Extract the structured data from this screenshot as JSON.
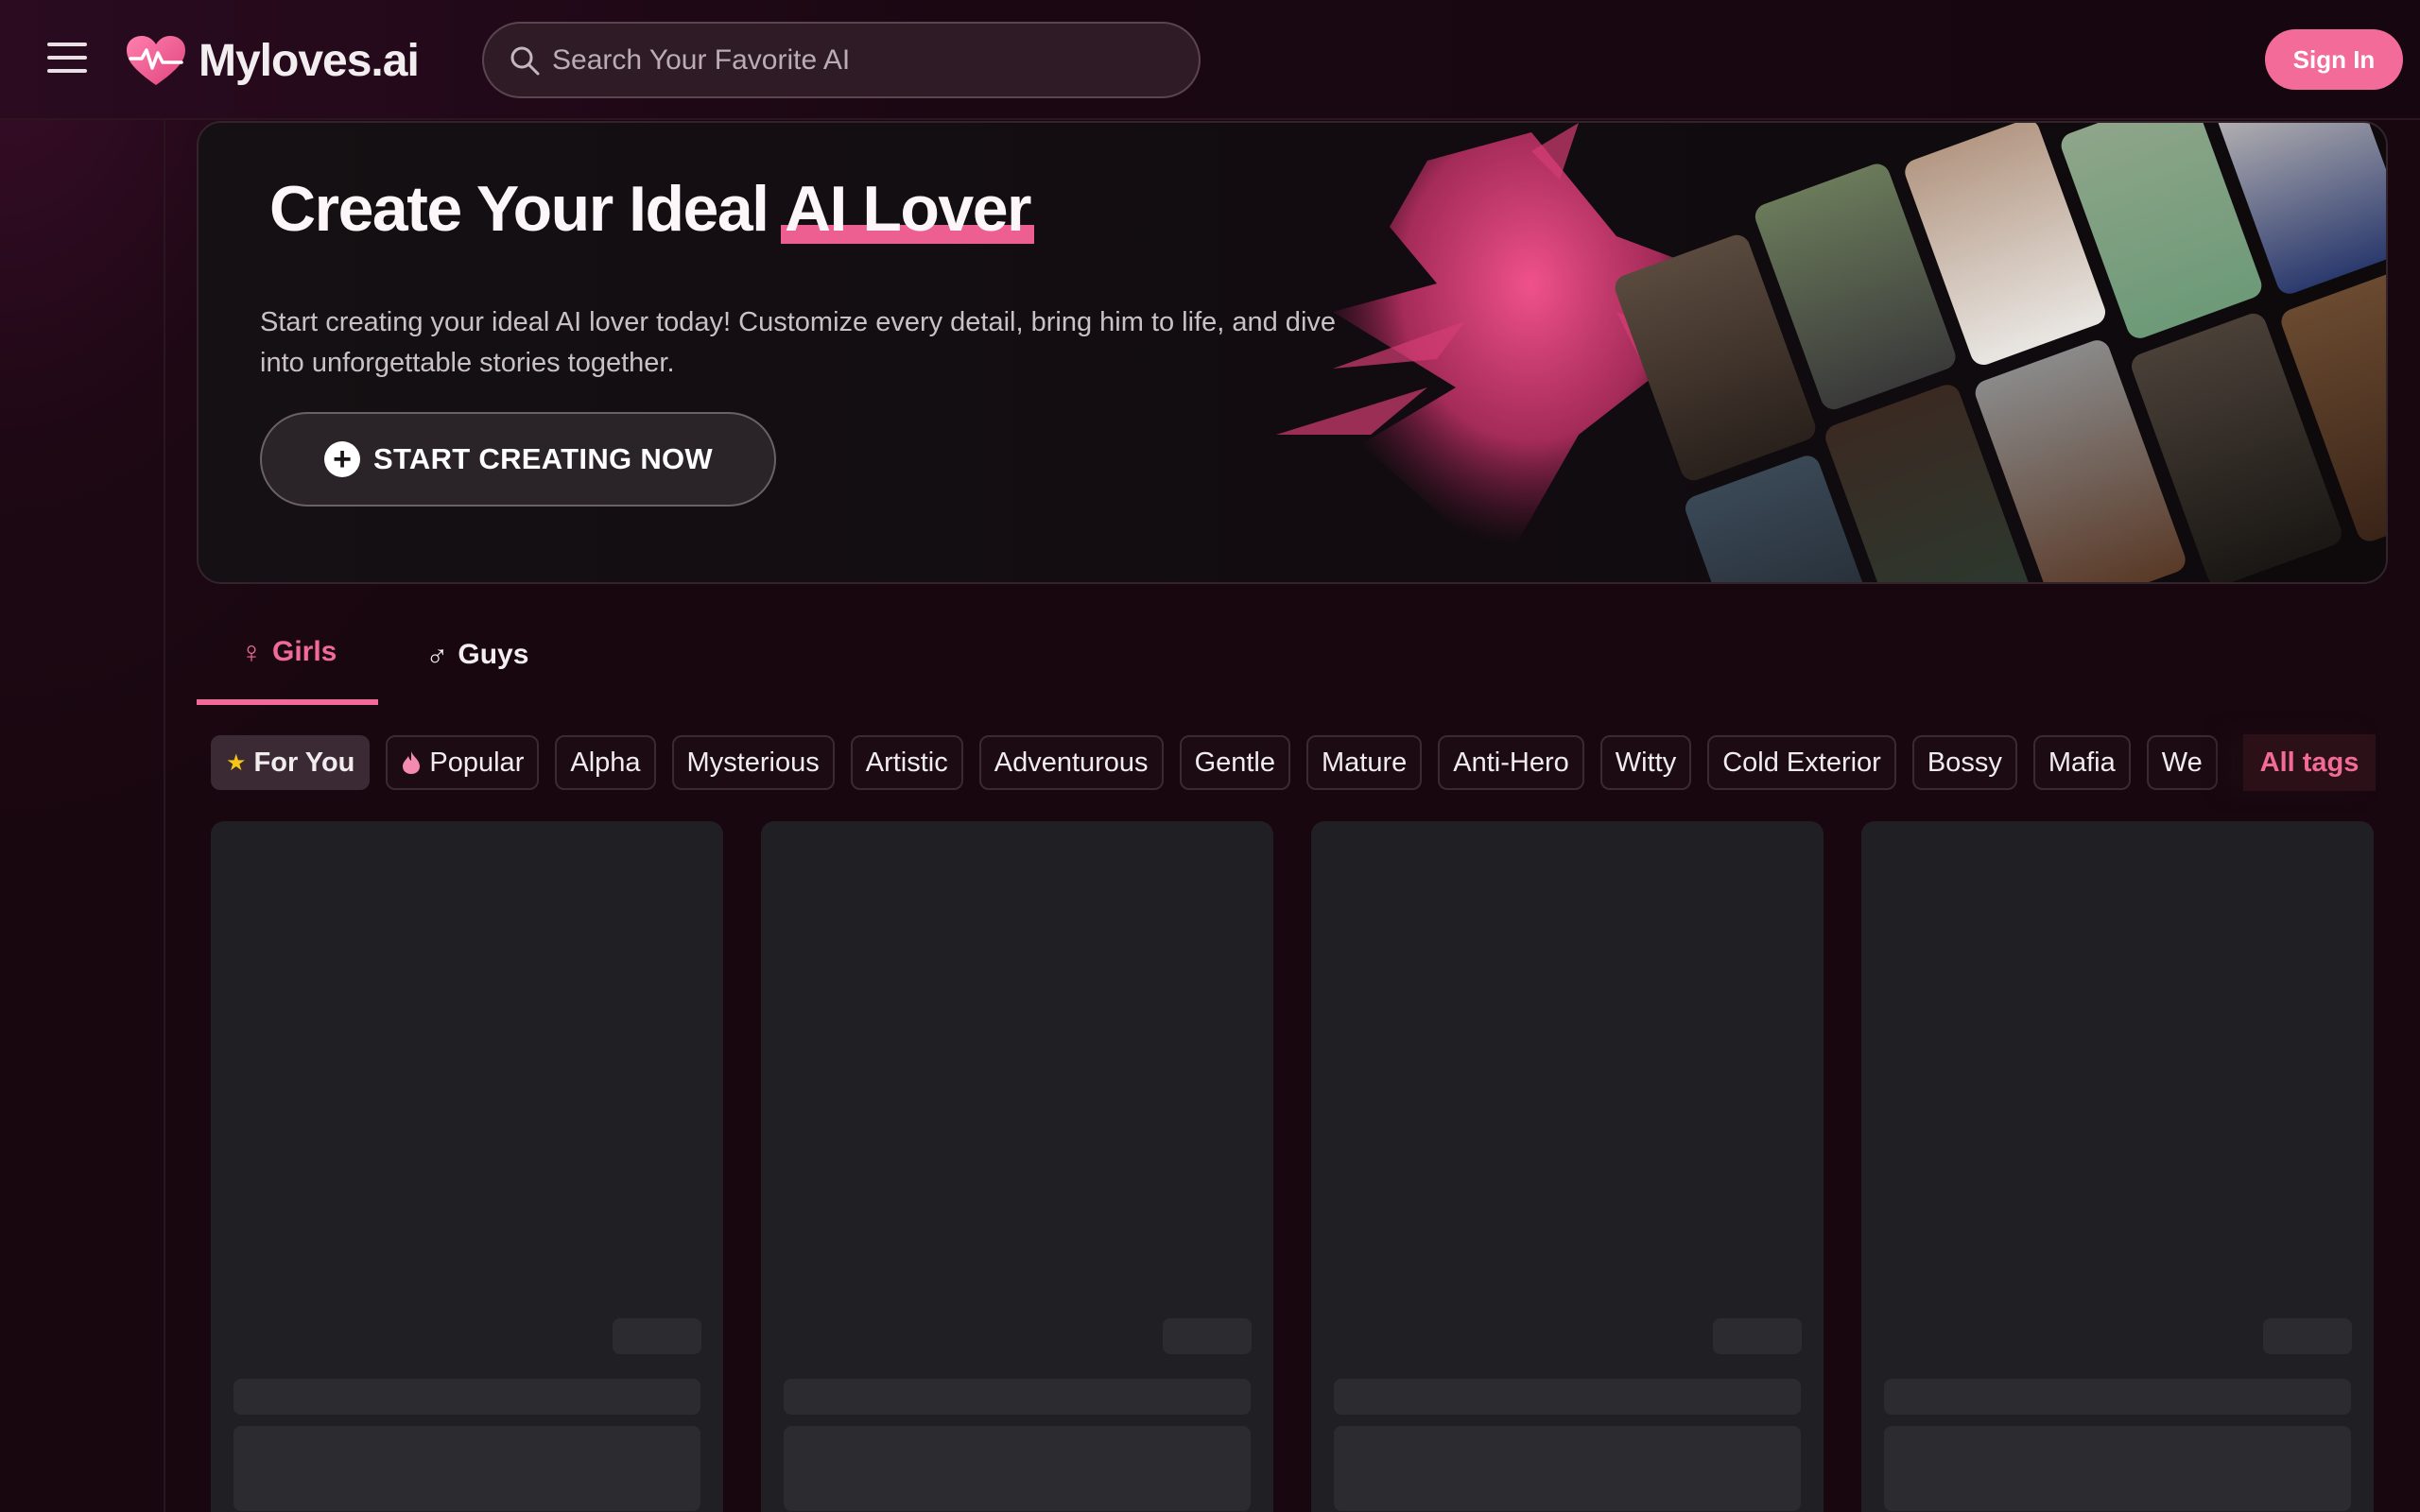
{
  "app": {
    "name": "Myloves.ai",
    "brand_color": "#f36c99"
  },
  "header": {
    "menu_icon": "hamburger-menu-icon",
    "logo_icon": "heart-pulse-icon",
    "search": {
      "placeholder": "Search Your Favorite AI",
      "value": "",
      "icon": "search-icon"
    },
    "signin_label": "Sign In"
  },
  "hero": {
    "title_plain": "Create Your Ideal",
    "title_highlight": "AI Lover",
    "description": "Start creating your ideal AI lover today! Customize every detail, bring him to life, and dive into unforgettable stories together.",
    "cta_label": "START CREATING NOW",
    "cta_icon": "plus-circle-icon"
  },
  "tabs": [
    {
      "label": "Girls",
      "icon": "female-symbol-icon",
      "active": true
    },
    {
      "label": "Guys",
      "icon": "male-symbol-icon",
      "active": false
    }
  ],
  "tags": [
    {
      "label": "For You",
      "icon": "star-badge-icon",
      "active": true
    },
    {
      "label": "Popular",
      "icon": "flame-icon",
      "active": false
    },
    {
      "label": "Alpha",
      "active": false
    },
    {
      "label": "Mysterious",
      "active": false
    },
    {
      "label": "Artistic",
      "active": false
    },
    {
      "label": "Adventurous",
      "active": false
    },
    {
      "label": "Gentle",
      "active": false
    },
    {
      "label": "Mature",
      "active": false
    },
    {
      "label": "Anti-Hero",
      "active": false
    },
    {
      "label": "Witty",
      "active": false
    },
    {
      "label": "Cold Exterior",
      "active": false
    },
    {
      "label": "Bossy",
      "active": false
    },
    {
      "label": "Mafia",
      "active": false
    },
    {
      "label": "We",
      "active": false
    }
  ],
  "all_tags_label": "All tags",
  "cards": [
    {
      "state": "loading"
    },
    {
      "state": "loading"
    },
    {
      "state": "loading"
    },
    {
      "state": "loading"
    }
  ]
}
